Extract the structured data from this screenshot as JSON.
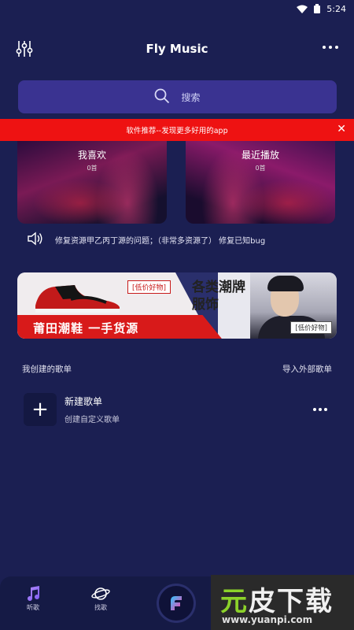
{
  "status_bar": {
    "time": "5:24"
  },
  "header": {
    "title": "Fly Music"
  },
  "search": {
    "placeholder": "搜索"
  },
  "promo_banner": {
    "text": "软件推荐--发现更多好用的app"
  },
  "cards": [
    {
      "label": "我喜欢",
      "count": "0首"
    },
    {
      "label": "最近播放",
      "count": "0首"
    }
  ],
  "notice": {
    "text": "修复资源甲乙丙丁源的问题；（非常多资源了） 修复已知bug"
  },
  "ad": {
    "tag_left": "[低价好物]",
    "main_text": "莆田潮鞋  一手货源",
    "right_line1": "各类潮牌",
    "right_line2": "服饰",
    "tag_right": "[低价好物]"
  },
  "playlists": {
    "section_title": "我创建的歌单",
    "import_label": "导入外部歌单",
    "new_item": {
      "icon_text": "+",
      "title": "新建歌单",
      "subtitle": "创建自定义歌单"
    }
  },
  "tabbar": {
    "listen_label": "听歌",
    "discover_label": "找歌"
  },
  "watermark": {
    "brand_green": "元",
    "brand_rest": "皮下载",
    "url": "www.yuanpi.com"
  },
  "colors": {
    "background": "#1b1f52",
    "search_bg": "#3a3391",
    "promo_red": "#ee1212",
    "tabbar_bg": "#151a45"
  },
  "icons": {
    "equalizer": "sliders-icon",
    "more": "more-dots-icon",
    "search": "search-icon",
    "close": "close-icon",
    "speaker": "speaker-icon",
    "listen": "music-note-icon",
    "discover": "planet-icon",
    "center": "fly-logo-icon"
  }
}
